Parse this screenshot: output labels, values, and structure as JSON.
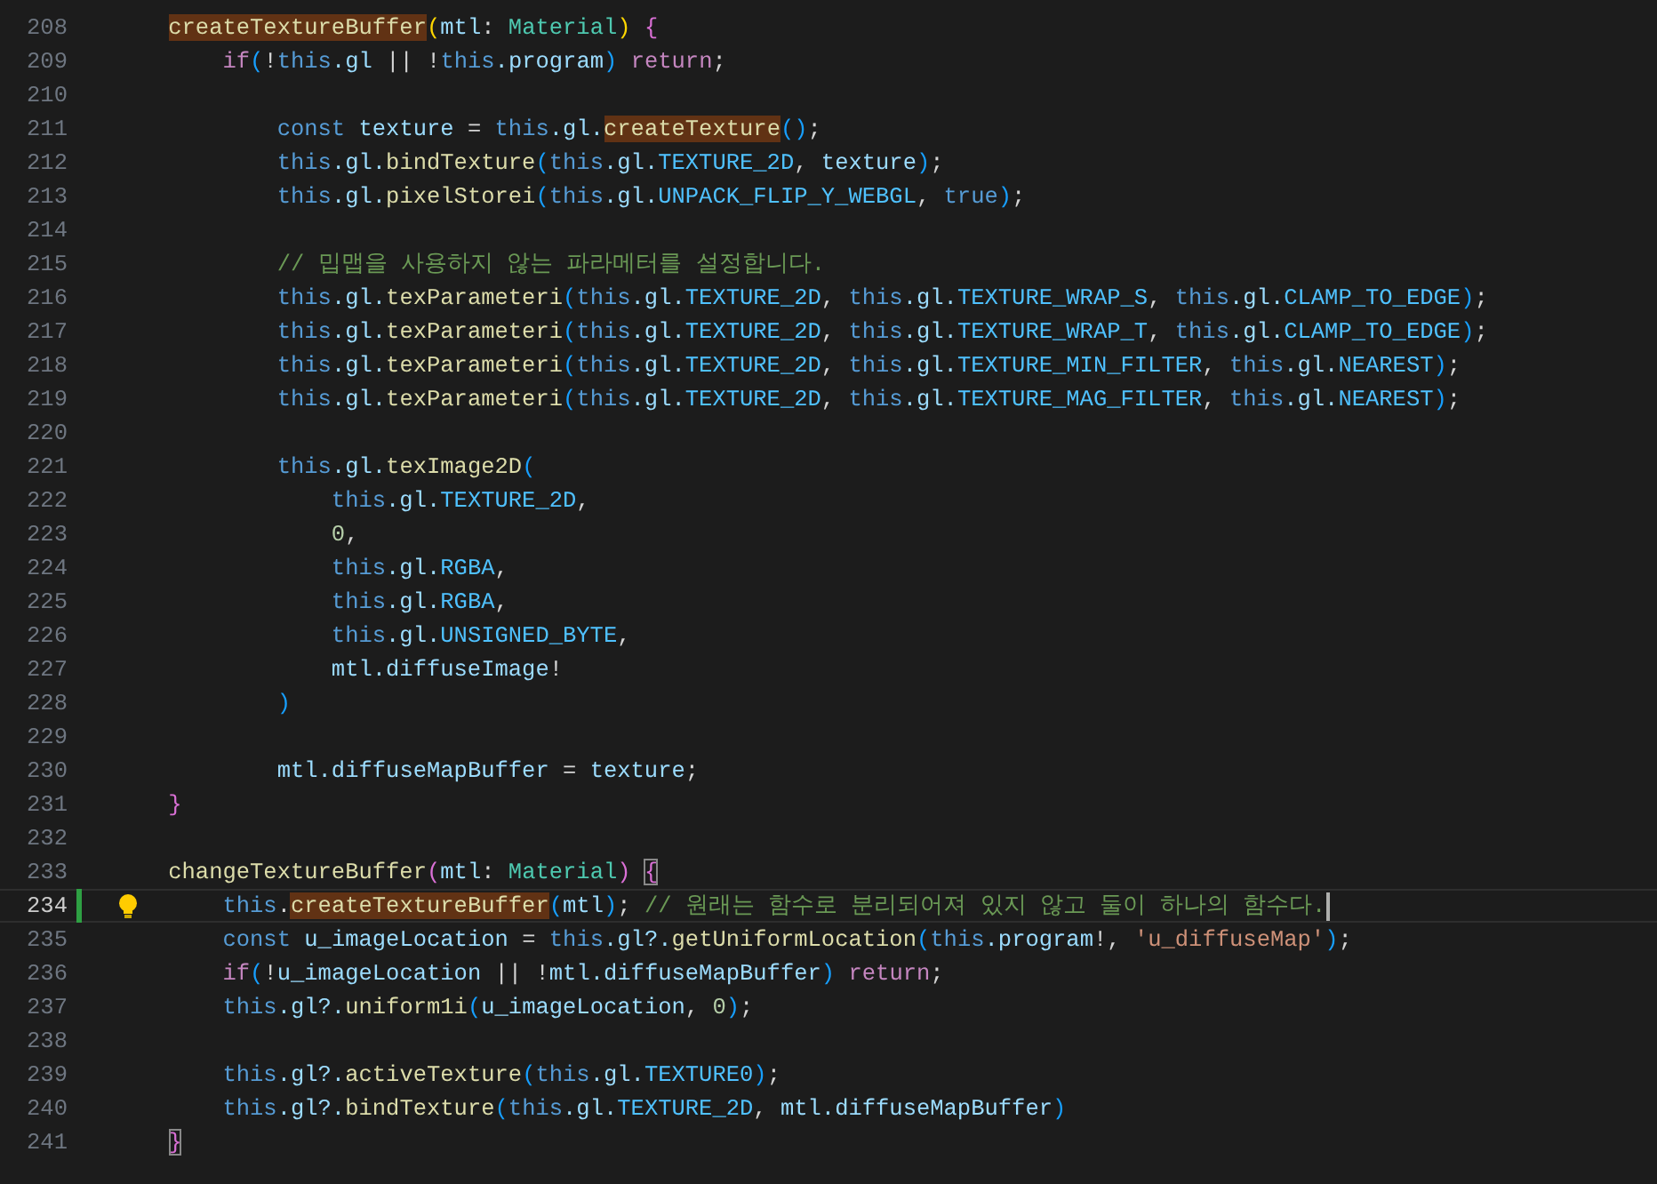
{
  "editor": {
    "lines": [
      {
        "number": "208",
        "tokens": [
          {
            "text": "    createTextureBuffer",
            "kind": "f",
            "highlighted": true
          },
          {
            "text": "(",
            "kind": "b1"
          },
          {
            "text": "mtl",
            "kind": "v"
          },
          {
            "text": ": ",
            "kind": "p"
          },
          {
            "text": "Material",
            "kind": "ty"
          },
          {
            "text": ") ",
            "kind": "b1"
          },
          {
            "text": "{",
            "kind": "b2"
          }
        ]
      },
      {
        "number": "209",
        "tokens": [
          {
            "text": "        if",
            "kind": "kw"
          },
          {
            "text": "(",
            "kind": "b3"
          },
          {
            "text": "!",
            "kind": "p"
          },
          {
            "text": "this",
            "kind": "st"
          },
          {
            "text": ".gl",
            "kind": "v"
          },
          {
            "text": " || !",
            "kind": "p"
          },
          {
            "text": "this",
            "kind": "st"
          },
          {
            "text": ".program",
            "kind": "v"
          },
          {
            "text": ") ",
            "kind": "b3"
          },
          {
            "text": "return",
            "kind": "kw"
          },
          {
            "text": ";",
            "kind": "p"
          }
        ]
      },
      {
        "number": "210"
      },
      {
        "number": "211",
        "tokens": [
          {
            "text": "            const",
            "kind": "st"
          },
          {
            "text": " texture",
            "kind": "v"
          },
          {
            "text": " = ",
            "kind": "p"
          },
          {
            "text": "this",
            "kind": "st"
          },
          {
            "text": ".gl.",
            "kind": "v"
          },
          {
            "text": "createTexture",
            "kind": "f",
            "highlighted": true
          },
          {
            "text": "()",
            "kind": "b3"
          },
          {
            "text": ";",
            "kind": "p"
          }
        ]
      },
      {
        "number": "212",
        "tokens": [
          {
            "text": "            this",
            "kind": "st"
          },
          {
            "text": ".gl.",
            "kind": "v"
          },
          {
            "text": "bindTexture",
            "kind": "f"
          },
          {
            "text": "(",
            "kind": "b3"
          },
          {
            "text": "this",
            "kind": "st"
          },
          {
            "text": ".gl.",
            "kind": "v"
          },
          {
            "text": "TEXTURE_2D",
            "kind": "c"
          },
          {
            "text": ", ",
            "kind": "p"
          },
          {
            "text": "texture",
            "kind": "v"
          },
          {
            "text": ")",
            "kind": "b3"
          },
          {
            "text": ";",
            "kind": "p"
          }
        ]
      },
      {
        "number": "213",
        "tokens": [
          {
            "text": "            this",
            "kind": "st"
          },
          {
            "text": ".gl.",
            "kind": "v"
          },
          {
            "text": "pixelStorei",
            "kind": "f"
          },
          {
            "text": "(",
            "kind": "b3"
          },
          {
            "text": "this",
            "kind": "st"
          },
          {
            "text": ".gl.",
            "kind": "v"
          },
          {
            "text": "UNPACK_FLIP_Y_WEBGL",
            "kind": "c"
          },
          {
            "text": ", ",
            "kind": "p"
          },
          {
            "text": "true",
            "kind": "st"
          },
          {
            "text": ")",
            "kind": "b3"
          },
          {
            "text": ";",
            "kind": "p"
          }
        ]
      },
      {
        "number": "214"
      },
      {
        "number": "215",
        "tokens": [
          {
            "text": "            // 밉맵을 사용하지 않는 파라메터를 설정합니다.",
            "kind": "cm"
          }
        ]
      },
      {
        "number": "216",
        "tokens": [
          {
            "text": "            this",
            "kind": "st"
          },
          {
            "text": ".gl.",
            "kind": "v"
          },
          {
            "text": "texParameteri",
            "kind": "f"
          },
          {
            "text": "(",
            "kind": "b3"
          },
          {
            "text": "this",
            "kind": "st"
          },
          {
            "text": ".gl.",
            "kind": "v"
          },
          {
            "text": "TEXTURE_2D",
            "kind": "c"
          },
          {
            "text": ", ",
            "kind": "p"
          },
          {
            "text": "this",
            "kind": "st"
          },
          {
            "text": ".gl.",
            "kind": "v"
          },
          {
            "text": "TEXTURE_WRAP_S",
            "kind": "c"
          },
          {
            "text": ", ",
            "kind": "p"
          },
          {
            "text": "this",
            "kind": "st"
          },
          {
            "text": ".gl.",
            "kind": "v"
          },
          {
            "text": "CLAMP_TO_EDGE",
            "kind": "c"
          },
          {
            "text": ")",
            "kind": "b3"
          },
          {
            "text": ";",
            "kind": "p"
          }
        ]
      },
      {
        "number": "217",
        "tokens": [
          {
            "text": "            this",
            "kind": "st"
          },
          {
            "text": ".gl.",
            "kind": "v"
          },
          {
            "text": "texParameteri",
            "kind": "f"
          },
          {
            "text": "(",
            "kind": "b3"
          },
          {
            "text": "this",
            "kind": "st"
          },
          {
            "text": ".gl.",
            "kind": "v"
          },
          {
            "text": "TEXTURE_2D",
            "kind": "c"
          },
          {
            "text": ", ",
            "kind": "p"
          },
          {
            "text": "this",
            "kind": "st"
          },
          {
            "text": ".gl.",
            "kind": "v"
          },
          {
            "text": "TEXTURE_WRAP_T",
            "kind": "c"
          },
          {
            "text": ", ",
            "kind": "p"
          },
          {
            "text": "this",
            "kind": "st"
          },
          {
            "text": ".gl.",
            "kind": "v"
          },
          {
            "text": "CLAMP_TO_EDGE",
            "kind": "c"
          },
          {
            "text": ")",
            "kind": "b3"
          },
          {
            "text": ";",
            "kind": "p"
          }
        ]
      },
      {
        "number": "218",
        "tokens": [
          {
            "text": "            this",
            "kind": "st"
          },
          {
            "text": ".gl.",
            "kind": "v"
          },
          {
            "text": "texParameteri",
            "kind": "f"
          },
          {
            "text": "(",
            "kind": "b3"
          },
          {
            "text": "this",
            "kind": "st"
          },
          {
            "text": ".gl.",
            "kind": "v"
          },
          {
            "text": "TEXTURE_2D",
            "kind": "c"
          },
          {
            "text": ", ",
            "kind": "p"
          },
          {
            "text": "this",
            "kind": "st"
          },
          {
            "text": ".gl.",
            "kind": "v"
          },
          {
            "text": "TEXTURE_MIN_FILTER",
            "kind": "c"
          },
          {
            "text": ", ",
            "kind": "p"
          },
          {
            "text": "this",
            "kind": "st"
          },
          {
            "text": ".gl.",
            "kind": "v"
          },
          {
            "text": "NEAREST",
            "kind": "c"
          },
          {
            "text": ")",
            "kind": "b3"
          },
          {
            "text": ";",
            "kind": "p"
          }
        ]
      },
      {
        "number": "219",
        "tokens": [
          {
            "text": "            this",
            "kind": "st"
          },
          {
            "text": ".gl.",
            "kind": "v"
          },
          {
            "text": "texParameteri",
            "kind": "f"
          },
          {
            "text": "(",
            "kind": "b3"
          },
          {
            "text": "this",
            "kind": "st"
          },
          {
            "text": ".gl.",
            "kind": "v"
          },
          {
            "text": "TEXTURE_2D",
            "kind": "c"
          },
          {
            "text": ", ",
            "kind": "p"
          },
          {
            "text": "this",
            "kind": "st"
          },
          {
            "text": ".gl.",
            "kind": "v"
          },
          {
            "text": "TEXTURE_MAG_FILTER",
            "kind": "c"
          },
          {
            "text": ", ",
            "kind": "p"
          },
          {
            "text": "this",
            "kind": "st"
          },
          {
            "text": ".gl.",
            "kind": "v"
          },
          {
            "text": "NEAREST",
            "kind": "c"
          },
          {
            "text": ")",
            "kind": "b3"
          },
          {
            "text": ";",
            "kind": "p"
          }
        ]
      },
      {
        "number": "220"
      },
      {
        "number": "221",
        "tokens": [
          {
            "text": "            this",
            "kind": "st"
          },
          {
            "text": ".gl.",
            "kind": "v"
          },
          {
            "text": "texImage2D",
            "kind": "f"
          },
          {
            "text": "(",
            "kind": "b3"
          }
        ]
      },
      {
        "number": "222",
        "tokens": [
          {
            "text": "                this",
            "kind": "st"
          },
          {
            "text": ".gl.",
            "kind": "v"
          },
          {
            "text": "TEXTURE_2D",
            "kind": "c"
          },
          {
            "text": ",",
            "kind": "p"
          }
        ]
      },
      {
        "number": "223",
        "tokens": [
          {
            "text": "                0",
            "kind": "n"
          },
          {
            "text": ",",
            "kind": "p"
          }
        ]
      },
      {
        "number": "224",
        "tokens": [
          {
            "text": "                this",
            "kind": "st"
          },
          {
            "text": ".gl.",
            "kind": "v"
          },
          {
            "text": "RGBA",
            "kind": "c"
          },
          {
            "text": ",",
            "kind": "p"
          }
        ]
      },
      {
        "number": "225",
        "tokens": [
          {
            "text": "                this",
            "kind": "st"
          },
          {
            "text": ".gl.",
            "kind": "v"
          },
          {
            "text": "RGBA",
            "kind": "c"
          },
          {
            "text": ",",
            "kind": "p"
          }
        ]
      },
      {
        "number": "226",
        "tokens": [
          {
            "text": "                this",
            "kind": "st"
          },
          {
            "text": ".gl.",
            "kind": "v"
          },
          {
            "text": "UNSIGNED_BYTE",
            "kind": "c"
          },
          {
            "text": ",",
            "kind": "p"
          }
        ]
      },
      {
        "number": "227",
        "tokens": [
          {
            "text": "                mtl.diffuseImage",
            "kind": "v"
          },
          {
            "text": "!",
            "kind": "p"
          }
        ]
      },
      {
        "number": "228",
        "tokens": [
          {
            "text": "            )",
            "kind": "b3"
          }
        ]
      },
      {
        "number": "229"
      },
      {
        "number": "230",
        "tokens": [
          {
            "text": "            mtl.diffuseMapBuffer",
            "kind": "v"
          },
          {
            "text": " = ",
            "kind": "p"
          },
          {
            "text": "texture",
            "kind": "v"
          },
          {
            "text": ";",
            "kind": "p"
          }
        ]
      },
      {
        "number": "231",
        "tokens": [
          {
            "text": "    }",
            "kind": "b2"
          }
        ]
      },
      {
        "number": "232"
      },
      {
        "number": "233",
        "tokens": [
          {
            "text": "    changeTextureBuffer",
            "kind": "f"
          },
          {
            "text": "(",
            "kind": "b2"
          },
          {
            "text": "mtl",
            "kind": "v"
          },
          {
            "text": ": ",
            "kind": "p"
          },
          {
            "text": "Material",
            "kind": "ty"
          },
          {
            "text": ") ",
            "kind": "b2"
          },
          {
            "text": "{",
            "kind": "b2",
            "boxed": true
          }
        ]
      },
      {
        "number": "234",
        "current": true,
        "modified": true,
        "lightbulb": true,
        "cursor": true,
        "tokens": [
          {
            "text": "        this",
            "kind": "st"
          },
          {
            "text": ".",
            "kind": "p"
          },
          {
            "text": "createTextureBuffer",
            "kind": "f",
            "highlighted": true
          },
          {
            "text": "(",
            "kind": "b3"
          },
          {
            "text": "mtl",
            "kind": "v"
          },
          {
            "text": ")",
            "kind": "b3"
          },
          {
            "text": "; ",
            "kind": "p"
          },
          {
            "text": "// 원래는 함수로 분리되어져 있지 않고 둘이 하나의 함수다.",
            "kind": "cm"
          }
        ]
      },
      {
        "number": "235",
        "tokens": [
          {
            "text": "        const",
            "kind": "st"
          },
          {
            "text": " u_imageLocation",
            "kind": "v"
          },
          {
            "text": " = ",
            "kind": "p"
          },
          {
            "text": "this",
            "kind": "st"
          },
          {
            "text": ".gl?.",
            "kind": "v"
          },
          {
            "text": "getUniformLocation",
            "kind": "f"
          },
          {
            "text": "(",
            "kind": "b3"
          },
          {
            "text": "this",
            "kind": "st"
          },
          {
            "text": ".program",
            "kind": "v"
          },
          {
            "text": "!, ",
            "kind": "p"
          },
          {
            "text": "'u_diffuseMap'",
            "kind": "s"
          },
          {
            "text": ")",
            "kind": "b3"
          },
          {
            "text": ";",
            "kind": "p"
          }
        ]
      },
      {
        "number": "236",
        "tokens": [
          {
            "text": "        if",
            "kind": "kw"
          },
          {
            "text": "(",
            "kind": "b3"
          },
          {
            "text": "!",
            "kind": "p"
          },
          {
            "text": "u_imageLocation",
            "kind": "v"
          },
          {
            "text": " || !",
            "kind": "p"
          },
          {
            "text": "mtl.diffuseMapBuffer",
            "kind": "v"
          },
          {
            "text": ") ",
            "kind": "b3"
          },
          {
            "text": "return",
            "kind": "kw"
          },
          {
            "text": ";",
            "kind": "p"
          }
        ]
      },
      {
        "number": "237",
        "tokens": [
          {
            "text": "        this",
            "kind": "st"
          },
          {
            "text": ".gl?.",
            "kind": "v"
          },
          {
            "text": "uniform1i",
            "kind": "f"
          },
          {
            "text": "(",
            "kind": "b3"
          },
          {
            "text": "u_imageLocation",
            "kind": "v"
          },
          {
            "text": ", ",
            "kind": "p"
          },
          {
            "text": "0",
            "kind": "n"
          },
          {
            "text": ")",
            "kind": "b3"
          },
          {
            "text": ";",
            "kind": "p"
          }
        ]
      },
      {
        "number": "238"
      },
      {
        "number": "239",
        "tokens": [
          {
            "text": "        this",
            "kind": "st"
          },
          {
            "text": ".gl?.",
            "kind": "v"
          },
          {
            "text": "activeTexture",
            "kind": "f"
          },
          {
            "text": "(",
            "kind": "b3"
          },
          {
            "text": "this",
            "kind": "st"
          },
          {
            "text": ".gl.",
            "kind": "v"
          },
          {
            "text": "TEXTURE0",
            "kind": "c"
          },
          {
            "text": ")",
            "kind": "b3"
          },
          {
            "text": ";",
            "kind": "p"
          }
        ]
      },
      {
        "number": "240",
        "tokens": [
          {
            "text": "        this",
            "kind": "st"
          },
          {
            "text": ".gl?.",
            "kind": "v"
          },
          {
            "text": "bindTexture",
            "kind": "f"
          },
          {
            "text": "(",
            "kind": "b3"
          },
          {
            "text": "this",
            "kind": "st"
          },
          {
            "text": ".gl.",
            "kind": "v"
          },
          {
            "text": "TEXTURE_2D",
            "kind": "c"
          },
          {
            "text": ", ",
            "kind": "p"
          },
          {
            "text": "mtl.diffuseMapBuffer",
            "kind": "v"
          },
          {
            "text": ")",
            "kind": "b3"
          }
        ]
      },
      {
        "number": "241",
        "tokens": [
          {
            "text": "    }",
            "kind": "b2",
            "boxed": true
          }
        ]
      }
    ]
  }
}
